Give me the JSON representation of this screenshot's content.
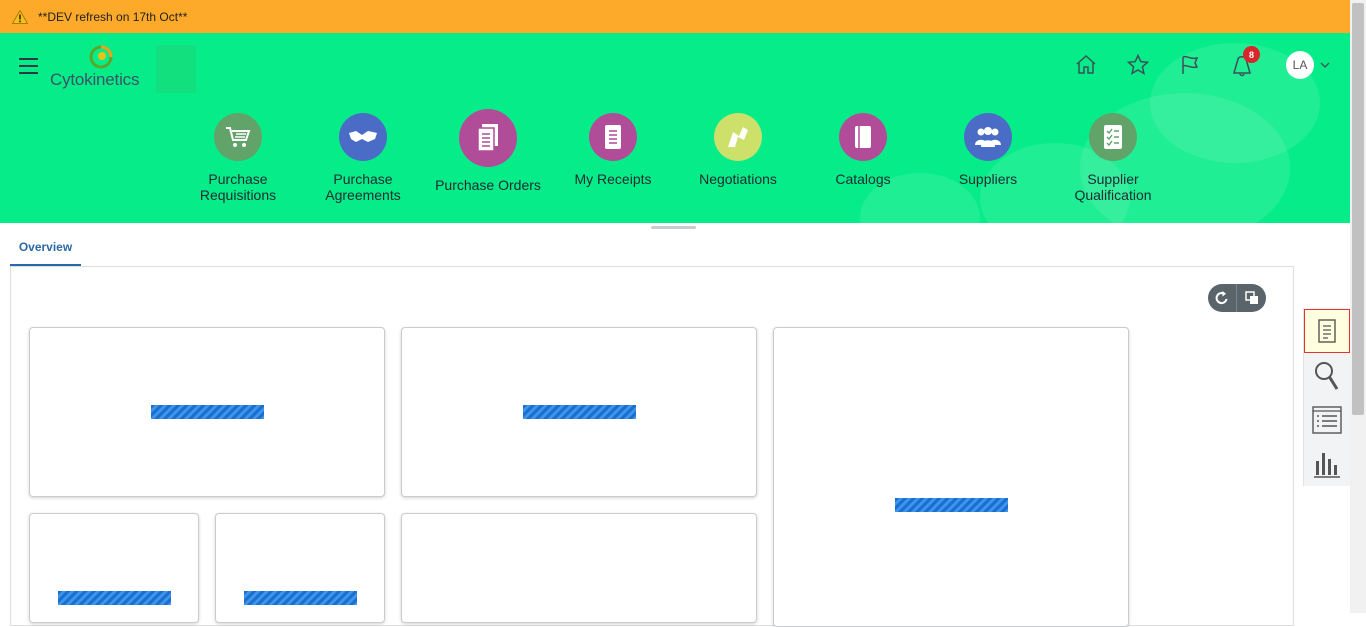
{
  "banner": {
    "text": "**DEV refresh on 17th Oct**",
    "icon": "warning-icon"
  },
  "header": {
    "brand": "Cytokinetics",
    "notifications_count": "8",
    "user_initials": "LA",
    "colors": {
      "header_bg": "#06ec88",
      "banner_bg": "#fda92a",
      "badge": "#d9262b"
    }
  },
  "apps": [
    {
      "label": "Purchase Requisitions",
      "line1": "Purchase",
      "line2": "Requisitions",
      "color": "#62a36a",
      "icon": "shopping-cart-icon"
    },
    {
      "label": "Purchase Agreements",
      "line1": "Purchase",
      "line2": "Agreements",
      "color": "#4a6cc7",
      "icon": "handshake-icon"
    },
    {
      "label": "Purchase Orders",
      "line1": "Purchase Orders",
      "line2": "",
      "color": "#b14c99",
      "icon": "documents-icon"
    },
    {
      "label": "My Receipts",
      "line1": "My Receipts",
      "line2": "",
      "color": "#b14c99",
      "icon": "receipt-icon"
    },
    {
      "label": "Negotiations",
      "line1": "Negotiations",
      "line2": "",
      "color": "#cde06a",
      "icon": "negotiation-icon"
    },
    {
      "label": "Catalogs",
      "line1": "Catalogs",
      "line2": "",
      "color": "#b14c99",
      "icon": "catalog-icon"
    },
    {
      "label": "Suppliers",
      "line1": "Suppliers",
      "line2": "",
      "color": "#4a6cc7",
      "icon": "people-icon"
    },
    {
      "label": "Supplier Qualification",
      "line1": "Supplier",
      "line2": "Qualification",
      "color": "#62a36a",
      "icon": "checklist-icon"
    }
  ],
  "tabs": {
    "overview": "Overview"
  },
  "side_rail": [
    "tasks-icon",
    "search-icon",
    "list-icon",
    "bar-chart-icon"
  ]
}
